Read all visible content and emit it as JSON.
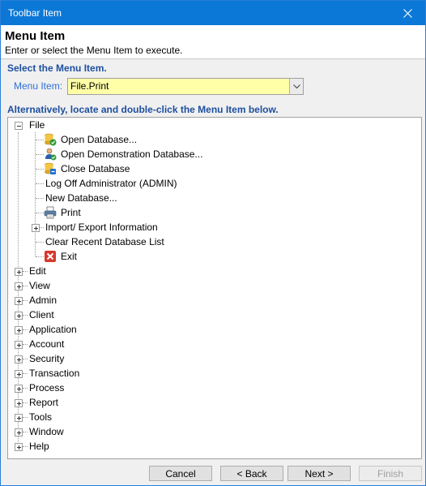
{
  "window": {
    "title": "Toolbar Item"
  },
  "header": {
    "title": "Menu Item",
    "subtitle": "Enter or select the Menu Item to execute."
  },
  "select_section": {
    "heading": "Select the Menu Item.",
    "label": "Menu Item:",
    "value": "File.Print"
  },
  "tree_section": {
    "heading": "Alternatively,  locate and double-click the Menu Item below."
  },
  "tree": {
    "file": {
      "label": "File"
    },
    "file_children": [
      {
        "label": "Open Database...",
        "icon": "database-open-icon"
      },
      {
        "label": "Open Demonstration Database...",
        "icon": "demo-database-icon"
      },
      {
        "label": "Close Database",
        "icon": "database-close-icon"
      },
      {
        "label": "Log Off Administrator (ADMIN)",
        "icon": ""
      },
      {
        "label": "New Database...",
        "icon": ""
      },
      {
        "label": "Print",
        "icon": "printer-icon"
      },
      {
        "label": "Import/ Export Information",
        "icon": ""
      },
      {
        "label": "Clear Recent Database List",
        "icon": ""
      },
      {
        "label": "Exit",
        "icon": "exit-icon"
      }
    ],
    "top_items": [
      "Edit",
      "View",
      "Admin",
      "Client",
      "Application",
      "Account",
      "Security",
      "Transaction",
      "Process",
      "Report",
      "Tools",
      "Window",
      "Help"
    ]
  },
  "buttons": {
    "cancel": "Cancel",
    "back": "< Back",
    "next": "Next >",
    "finish": "Finish"
  },
  "colors": {
    "titlebar": "#0b78d7",
    "heading": "#1e4fa0",
    "combo_bg": "#ffffa8",
    "label": "#2f6fd6"
  }
}
